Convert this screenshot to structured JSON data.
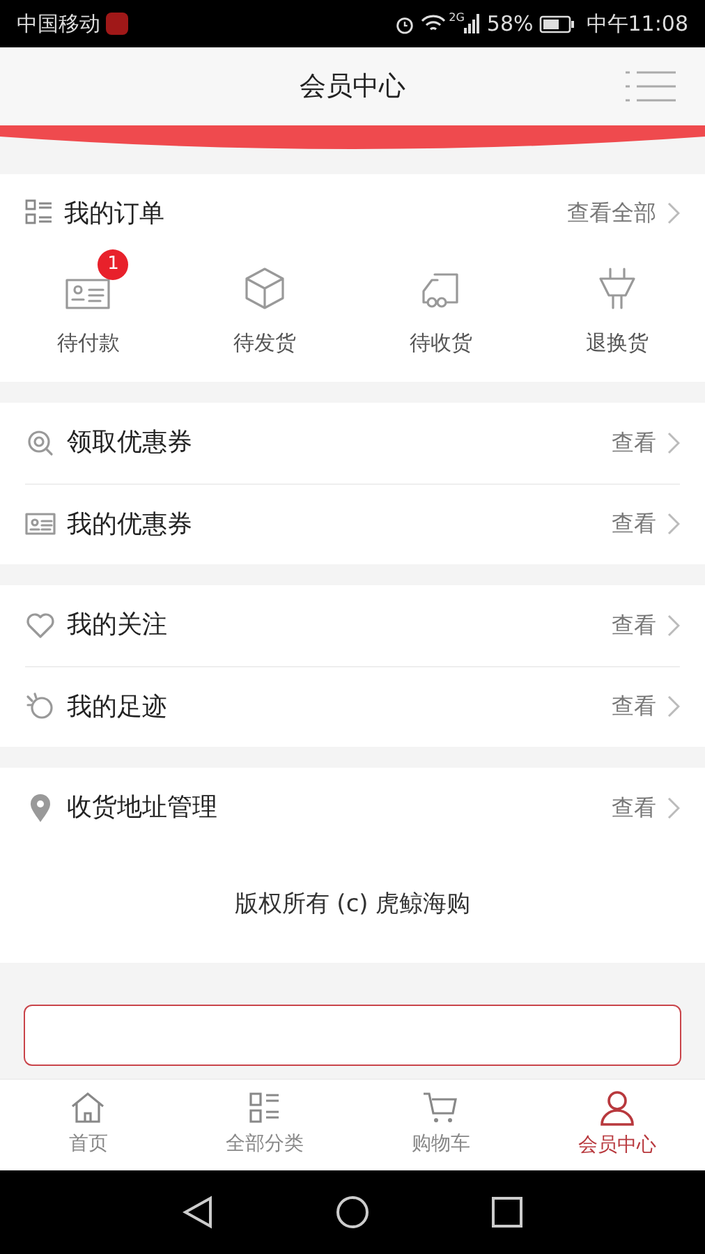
{
  "status_bar": {
    "carrier": "中国移动",
    "network": "2G",
    "battery": "58%",
    "time": "中午11:08"
  },
  "header": {
    "title": "会员中心"
  },
  "orders": {
    "title": "我的订单",
    "link": "查看全部",
    "items": [
      {
        "label": "待付款",
        "badge": "1"
      },
      {
        "label": "待发货"
      },
      {
        "label": "待收货"
      },
      {
        "label": "退换货"
      }
    ]
  },
  "groups": [
    [
      {
        "label": "领取优惠券",
        "link": "查看"
      },
      {
        "label": "我的优惠券",
        "link": "查看"
      }
    ],
    [
      {
        "label": "我的关注",
        "link": "查看"
      },
      {
        "label": "我的足迹",
        "link": "查看"
      }
    ],
    [
      {
        "label": "收货地址管理",
        "link": "查看"
      }
    ]
  ],
  "copyright": "版权所有 (c) 虎鲸海购",
  "tabs": [
    {
      "label": "首页",
      "selected": false
    },
    {
      "label": "全部分类",
      "selected": false
    },
    {
      "label": "购物车",
      "selected": false
    },
    {
      "label": "会员中心",
      "selected": true
    }
  ]
}
